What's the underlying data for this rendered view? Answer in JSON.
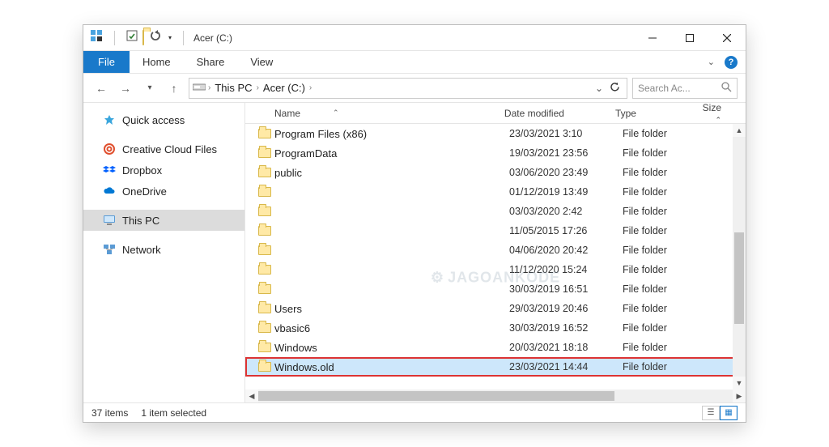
{
  "window": {
    "title": "Acer (C:)"
  },
  "ribbon": {
    "file": "File",
    "tabs": [
      "Home",
      "Share",
      "View"
    ]
  },
  "breadcrumb": {
    "items": [
      "This PC",
      "Acer (C:)"
    ]
  },
  "search": {
    "placeholder": "Search Ac..."
  },
  "sidebar": {
    "items": [
      {
        "label": "Quick access",
        "icon": "star",
        "color": "#3aa6dd"
      },
      {
        "label": "Creative Cloud Files",
        "icon": "cc",
        "color": "#e04f2e"
      },
      {
        "label": "Dropbox",
        "icon": "dropbox",
        "color": "#0061ff"
      },
      {
        "label": "OneDrive",
        "icon": "cloud",
        "color": "#0078d4"
      },
      {
        "label": "This PC",
        "icon": "pc",
        "color": "#5a9bd5",
        "selected": true
      },
      {
        "label": "Network",
        "icon": "network",
        "color": "#5a9bd5"
      }
    ]
  },
  "columns": {
    "name": "Name",
    "date": "Date modified",
    "type": "Type",
    "size": "Size"
  },
  "rows": [
    {
      "name": "Program Files (x86)",
      "date": "23/03/2021 3:10",
      "type": "File folder"
    },
    {
      "name": "ProgramData",
      "date": "19/03/2021 23:56",
      "type": "File folder"
    },
    {
      "name": "public",
      "date": "03/06/2020 23:49",
      "type": "File folder"
    },
    {
      "name": "",
      "date": "01/12/2019 13:49",
      "type": "File folder"
    },
    {
      "name": "",
      "date": "03/03/2020 2:42",
      "type": "File folder"
    },
    {
      "name": "",
      "date": "11/05/2015 17:26",
      "type": "File folder"
    },
    {
      "name": "",
      "date": "04/06/2020 20:42",
      "type": "File folder"
    },
    {
      "name": "",
      "date": "11/12/2020 15:24",
      "type": "File folder"
    },
    {
      "name": "",
      "date": "30/03/2019 16:51",
      "type": "File folder"
    },
    {
      "name": "Users",
      "date": "29/03/2019 20:46",
      "type": "File folder"
    },
    {
      "name": "vbasic6",
      "date": "30/03/2019 16:52",
      "type": "File folder"
    },
    {
      "name": "Windows",
      "date": "20/03/2021 18:18",
      "type": "File folder"
    },
    {
      "name": "Windows.old",
      "date": "23/03/2021 14:44",
      "type": "File folder",
      "highlighted": true
    }
  ],
  "status": {
    "count": "37 items",
    "selection": "1 item selected"
  },
  "watermark": "JAGOANKODE"
}
